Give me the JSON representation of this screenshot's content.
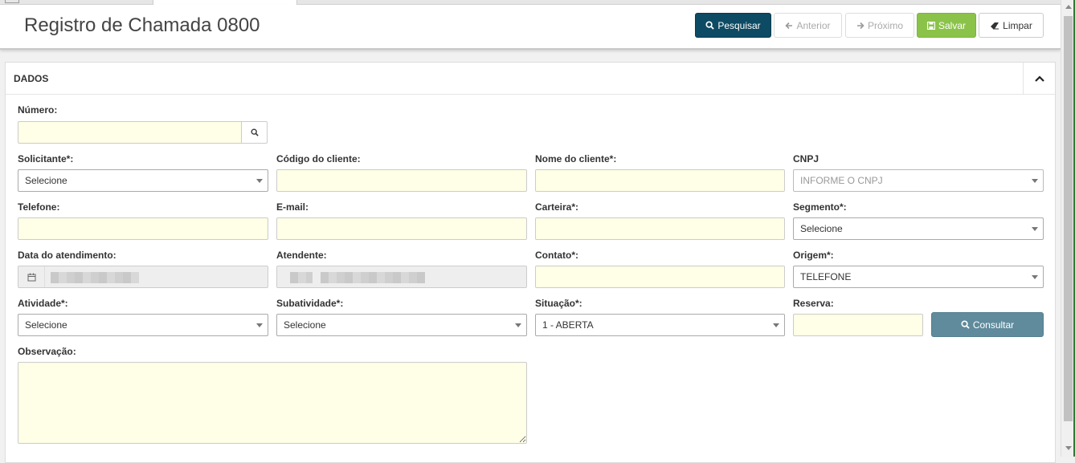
{
  "page": {
    "title": "Registro de Chamada 0800"
  },
  "toolbar": {
    "search_label": "Pesquisar",
    "prev_label": "Anterior",
    "next_label": "Próximo",
    "save_label": "Salvar",
    "clear_label": "Limpar"
  },
  "panel": {
    "title": "DADOS"
  },
  "form": {
    "numero_label": "Número:",
    "numero_value": "",
    "solicitante_label": "Solicitante*:",
    "solicitante_value": "Selecione",
    "codigo_label": "Código do cliente:",
    "nome_label": "Nome do cliente*:",
    "cnpj_label": "CNPJ",
    "cnpj_value": "INFORME O CNPJ",
    "telefone_label": "Telefone:",
    "email_label": "E-mail:",
    "carteira_label": "Carteira*:",
    "segmento_label": "Segmento*:",
    "segmento_value": "Selecione",
    "data_label": "Data do atendimento:",
    "atendente_label": "Atendente:",
    "contato_label": "Contato*:",
    "origem_label": "Origem*:",
    "origem_value": "TELEFONE",
    "atividade_label": "Atividade*:",
    "atividade_value": "Selecione",
    "subatividade_label": "Subatividade*:",
    "subatividade_value": "Selecione",
    "situacao_label": "Situação*:",
    "situacao_value": "1 - ABERTA",
    "reserva_label": "Reserva:",
    "consultar_label": "Consultar",
    "observacao_label": "Observação:"
  },
  "colors": {
    "primary": "#0d4a63",
    "success": "#8bc34a",
    "info": "#5f8b9c",
    "input_bg": "#fffee6"
  }
}
